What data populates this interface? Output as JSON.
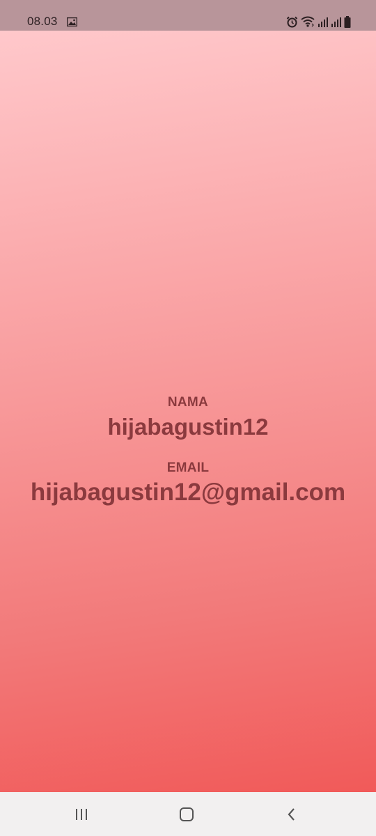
{
  "status_bar": {
    "time": "08.03",
    "icons": [
      "image-icon",
      "alarm-icon",
      "wifi-icon",
      "signal-icon",
      "signal-icon",
      "battery-icon"
    ]
  },
  "profile": {
    "name_label": "NAMA",
    "name_value": "hijabagustin12",
    "email_label": "EMAIL",
    "email_value": "hijabagustin12@gmail.com"
  },
  "colors": {
    "gradient_top": "#ffc8cb",
    "gradient_bottom": "#f15a59",
    "text": "#8b3a3e",
    "status_bar": "#b8959a",
    "nav_bar": "#f2f0f0"
  },
  "nav_bar": {
    "buttons": [
      "recents-icon",
      "home-icon",
      "back-icon"
    ]
  }
}
